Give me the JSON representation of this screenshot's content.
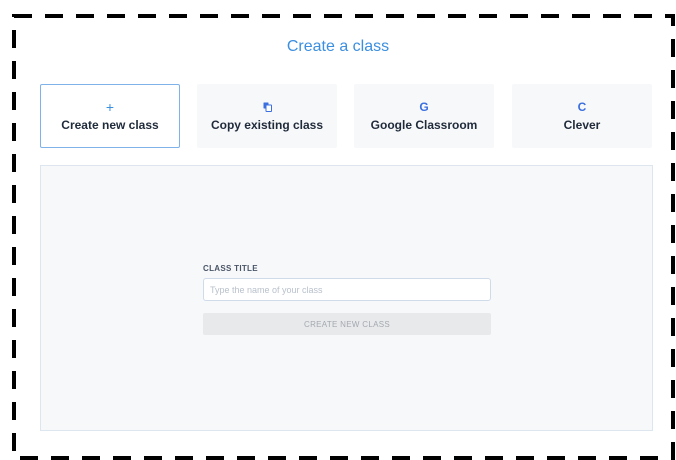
{
  "page": {
    "title": "Create a class"
  },
  "tabs": [
    {
      "label": "Create new class",
      "icon": "plus-icon",
      "active": true
    },
    {
      "label": "Copy existing class",
      "icon": "copy-icon",
      "active": false
    },
    {
      "label": "Google Classroom",
      "icon": "google-icon",
      "icon_glyph": "G",
      "active": false
    },
    {
      "label": "Clever",
      "icon": "clever-icon",
      "icon_glyph": "C",
      "active": false
    }
  ],
  "form": {
    "class_title_label": "CLASS TITLE",
    "class_title_placeholder": "Type the name of your class",
    "class_title_value": "",
    "submit_label": "CREATE NEW CLASS",
    "submit_disabled": true
  },
  "colors": {
    "accent": "#3b8fe0",
    "active_border": "#7fb2e8",
    "panel_bg": "#f7f8fa",
    "disabled_button": "#e8e9eb"
  }
}
